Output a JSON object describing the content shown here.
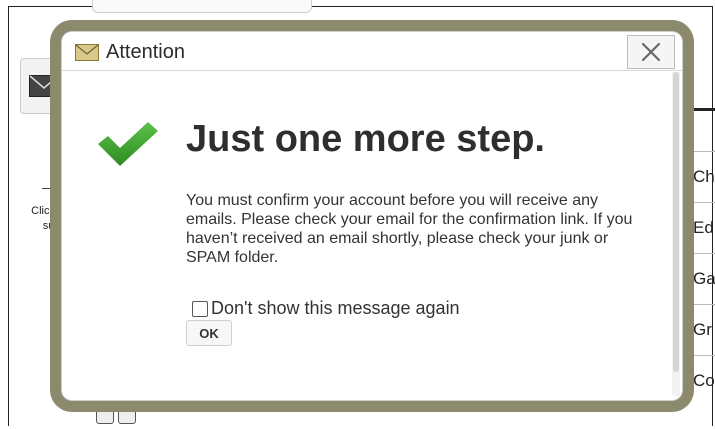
{
  "background": {
    "sidenote_lines": [
      "Click ic",
      "subs"
    ],
    "list_items": [
      "Ch",
      "Ed",
      "Ga",
      "Gr",
      "Cou"
    ]
  },
  "dialog": {
    "title": "Attention",
    "title_icon": "envelope-icon",
    "close_icon": "close-icon",
    "status_icon": "checkmark-icon",
    "headline": "Just one more step.",
    "message": "You must confirm your account before you will receive any emails. Please check your email for the confirmation link. If you haven’t received an email shortly, please check your junk or SPAM folder.",
    "dont_show_label": "Don't show this message again",
    "dont_show_checked": false,
    "ok_label": "OK"
  },
  "colors": {
    "frame": "#8b8a6d",
    "check_green": "#3c9c2c"
  }
}
